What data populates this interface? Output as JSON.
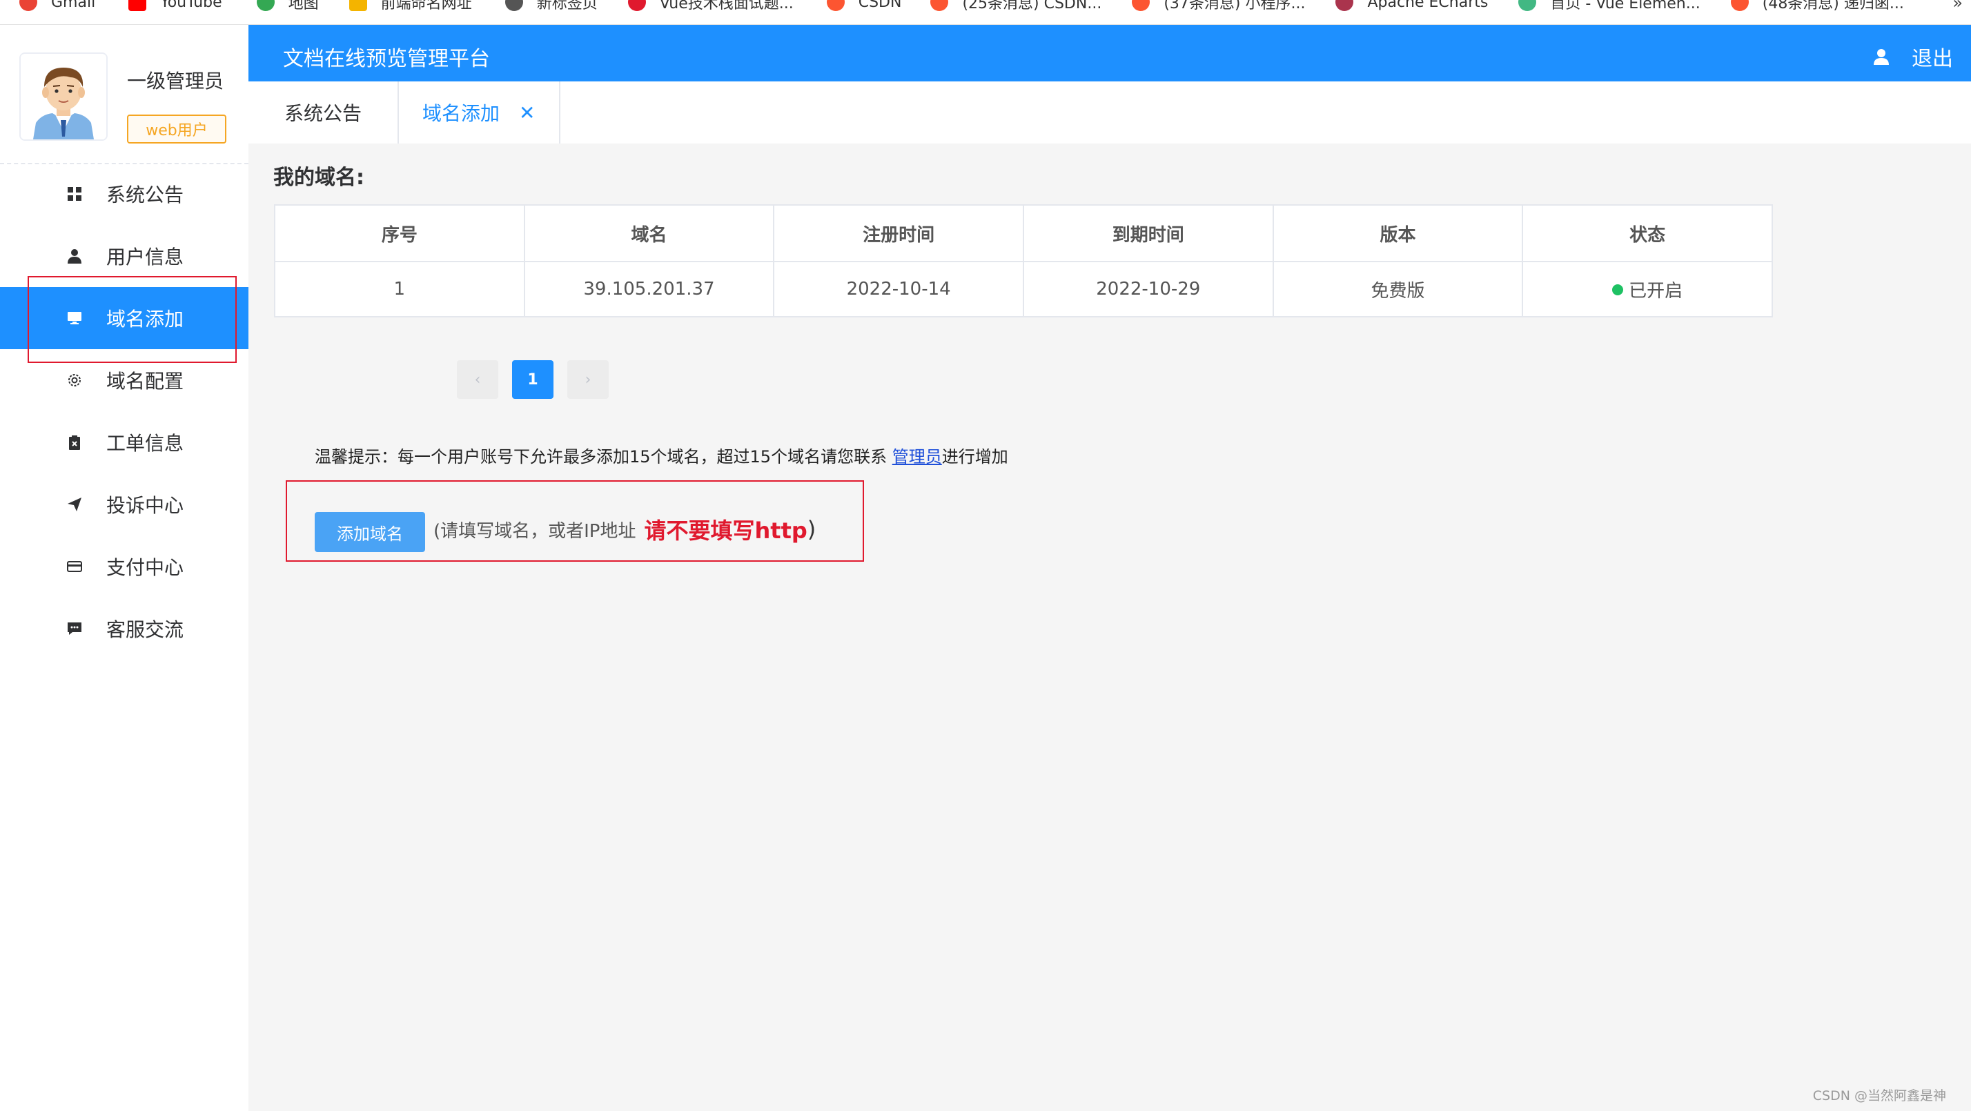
{
  "bookmarks": [
    {
      "label": "Gmail",
      "icon": "gmail-icon",
      "color": "#ea4335"
    },
    {
      "label": "YouTube",
      "icon": "youtube-icon",
      "color": "#ff0000"
    },
    {
      "label": "地图",
      "icon": "maps-icon",
      "color": "#34a853"
    },
    {
      "label": "前端命名网址",
      "icon": "bookmark-icon",
      "color": "#f4b400"
    },
    {
      "label": "新标签页",
      "icon": "globe-icon",
      "color": "#555555"
    },
    {
      "label": "Vue技术栈面试题...",
      "icon": "csdn-icon",
      "color": "#e0192e"
    },
    {
      "label": "CSDN",
      "icon": "csdn-icon",
      "color": "#fc5531"
    },
    {
      "label": "(25条消息) CSDN...",
      "icon": "csdn-icon",
      "color": "#fc5531"
    },
    {
      "label": "(37条消息) 小程序...",
      "icon": "csdn-icon",
      "color": "#fc5531"
    },
    {
      "label": "Apache ECharts",
      "icon": "echarts-icon",
      "color": "#aa344d"
    },
    {
      "label": "首页 - Vue Elemen...",
      "icon": "vue-icon",
      "color": "#42b883"
    },
    {
      "label": "(48条消息) 递归函...",
      "icon": "csdn-icon",
      "color": "#fc5531"
    }
  ],
  "bookmarks_more": "»",
  "sidebar": {
    "role_name": "一级管理员",
    "role_tag": "web用户",
    "items": [
      {
        "label": "系统公告",
        "icon": "grid-icon",
        "active": false
      },
      {
        "label": "用户信息",
        "icon": "user-icon",
        "active": false
      },
      {
        "label": "域名添加",
        "icon": "monitor-icon",
        "active": true
      },
      {
        "label": "域名配置",
        "icon": "gear-icon",
        "active": false
      },
      {
        "label": "工单信息",
        "icon": "clipboard-icon",
        "active": false
      },
      {
        "label": "投诉中心",
        "icon": "send-icon",
        "active": false
      },
      {
        "label": "支付中心",
        "icon": "card-icon",
        "active": false
      },
      {
        "label": "客服交流",
        "icon": "chat-icon",
        "active": false
      }
    ]
  },
  "header": {
    "title": "文档在线预览管理平台",
    "logout": "退出"
  },
  "tabs": [
    {
      "label": "系统公告",
      "active": false
    },
    {
      "label": "域名添加",
      "active": true,
      "close": "✕"
    }
  ],
  "main": {
    "section_title": "我的域名:",
    "table": {
      "columns": [
        "序号",
        "域名",
        "注册时间",
        "到期时间",
        "版本",
        "状态"
      ],
      "rows": [
        [
          "1",
          "39.105.201.37",
          "2022-10-14",
          "2022-10-29",
          "免费版",
          "已开启"
        ]
      ]
    },
    "pager": {
      "prev": "‹",
      "current": "1",
      "next": "›"
    },
    "tip_text": "温馨提示：每一个用户账号下允许最多添加15个域名，超过15个域名请您联系 ",
    "tip_link": "管理员",
    "tip_suffix": "进行增加",
    "add_button": "添加域名",
    "add_hint": "(请填写域名，或者IP地址 ",
    "add_warning": "请不要填写http",
    "add_close_paren": ")"
  },
  "watermark": "CSDN @当然阿鑫是神",
  "colors": {
    "primary": "#1e90ff",
    "highlight_border": "#e0192e",
    "status_on": "#1ec163",
    "tag_orange": "#f5a623"
  }
}
